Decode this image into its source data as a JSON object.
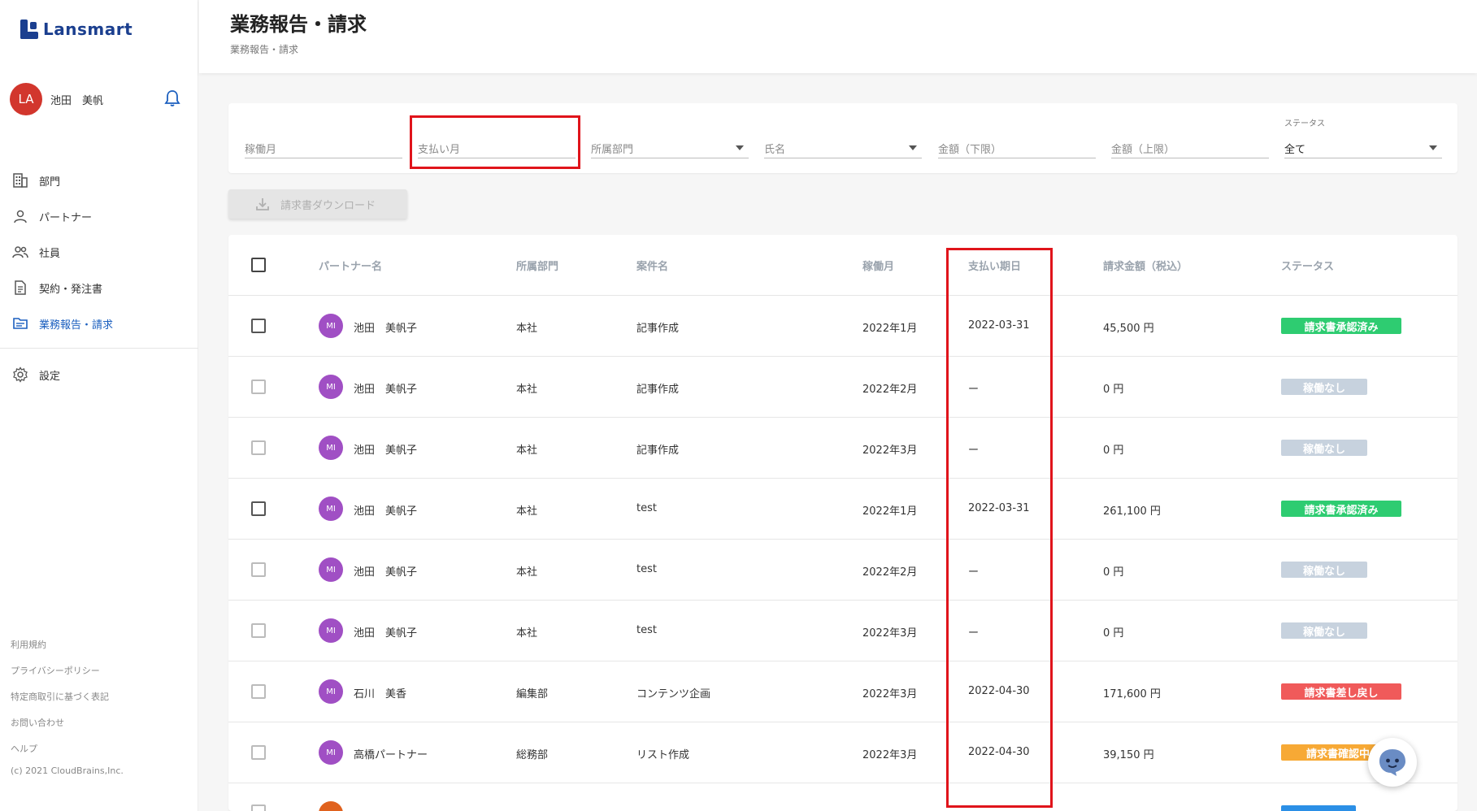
{
  "app": {
    "logo_text": "Lansmart",
    "brand_color": "#1b3f8f"
  },
  "user": {
    "initials": "LA",
    "name": "池田　美帆"
  },
  "sidebar": {
    "items": [
      {
        "label": "部門",
        "icon": "building-icon"
      },
      {
        "label": "パートナー",
        "icon": "person-icon"
      },
      {
        "label": "社員",
        "icon": "people-icon"
      },
      {
        "label": "契約・発注書",
        "icon": "document-icon"
      },
      {
        "label": "業務報告・請求",
        "icon": "folder-icon",
        "active": true
      }
    ],
    "settings": {
      "label": "設定",
      "icon": "gear-icon"
    },
    "footer_links": [
      "利用規約",
      "プライバシーポリシー",
      "特定商取引に基づく表記",
      "お問い合わせ",
      "ヘルプ"
    ],
    "copyright": "(c) 2021 CloudBrains,Inc."
  },
  "header": {
    "title": "業務報告・請求",
    "breadcrumb": "業務報告・請求"
  },
  "filters": {
    "work_month": {
      "placeholder": "稼働月"
    },
    "pay_month": {
      "placeholder": "支払い月"
    },
    "department": {
      "placeholder": "所属部門"
    },
    "name": {
      "placeholder": "氏名"
    },
    "amount_min": {
      "placeholder": "金額（下限）"
    },
    "amount_max": {
      "placeholder": "金額（上限）"
    },
    "status": {
      "label": "ステータス",
      "value": "全て"
    }
  },
  "download_button": {
    "label": "請求書ダウンロード"
  },
  "table": {
    "headers": {
      "partner": "パートナー名",
      "department": "所属部門",
      "project": "案件名",
      "work_month": "稼働月",
      "due_date": "支払い期日",
      "amount": "請求金額（税込）",
      "status": "ステータス"
    },
    "rows": [
      {
        "initials": "MI",
        "name": "池田　美帆子",
        "department": "本社",
        "project": "記事作成",
        "work_month": "2022年1月",
        "due_date": "2022-03-31",
        "amount": "45,500 円",
        "status": "請求書承認済み",
        "status_color": "#2ecc71"
      },
      {
        "initials": "MI",
        "name": "池田　美帆子",
        "department": "本社",
        "project": "記事作成",
        "work_month": "2022年2月",
        "due_date": "ー",
        "amount": "0 円",
        "status": "稼働なし",
        "status_color": "#c7d2de"
      },
      {
        "initials": "MI",
        "name": "池田　美帆子",
        "department": "本社",
        "project": "記事作成",
        "work_month": "2022年3月",
        "due_date": "ー",
        "amount": "0 円",
        "status": "稼働なし",
        "status_color": "#c7d2de"
      },
      {
        "initials": "MI",
        "name": "池田　美帆子",
        "department": "本社",
        "project": "test",
        "work_month": "2022年1月",
        "due_date": "2022-03-31",
        "amount": "261,100 円",
        "status": "請求書承認済み",
        "status_color": "#2ecc71"
      },
      {
        "initials": "MI",
        "name": "池田　美帆子",
        "department": "本社",
        "project": "test",
        "work_month": "2022年2月",
        "due_date": "ー",
        "amount": "0 円",
        "status": "稼働なし",
        "status_color": "#c7d2de"
      },
      {
        "initials": "MI",
        "name": "池田　美帆子",
        "department": "本社",
        "project": "test",
        "work_month": "2022年3月",
        "due_date": "ー",
        "amount": "0 円",
        "status": "稼働なし",
        "status_color": "#c7d2de"
      },
      {
        "initials": "MI",
        "name": "石川　美香",
        "department": "編集部",
        "project": "コンテンツ企画",
        "work_month": "2022年3月",
        "due_date": "2022-04-30",
        "amount": "171,600 円",
        "status": "請求書差し戻し",
        "status_color": "#f05a5a"
      },
      {
        "initials": "MI",
        "name": "高橋パートナー",
        "department": "総務部",
        "project": "リスト作成",
        "work_month": "2022年3月",
        "due_date": "2022-04-30",
        "amount": "39,150 円",
        "status": "請求書確認中",
        "status_color": "#f7a935"
      }
    ]
  }
}
